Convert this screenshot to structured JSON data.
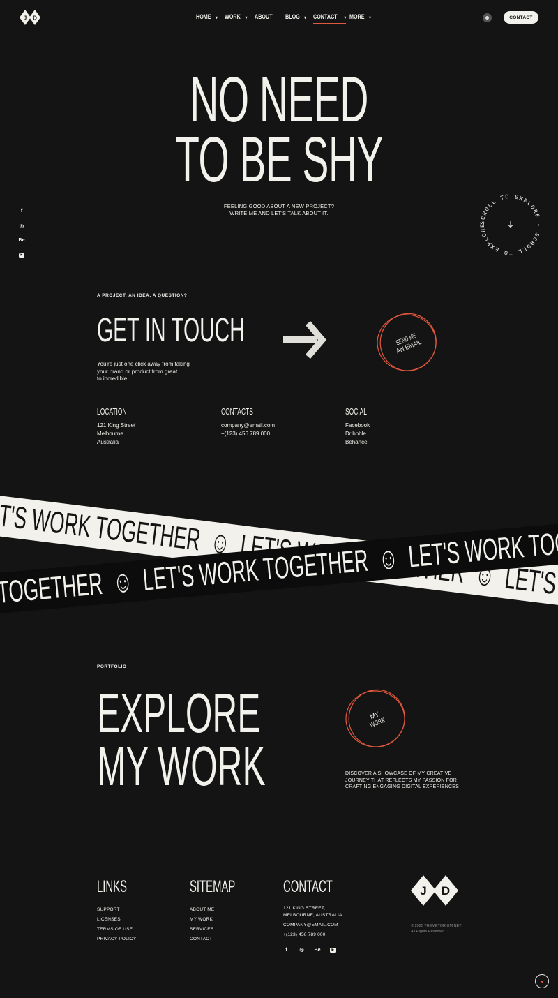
{
  "header": {
    "logo_text": "J D",
    "nav": [
      {
        "label": "HOME",
        "has_dropdown": true
      },
      {
        "label": "WORK",
        "has_dropdown": true
      },
      {
        "label": "ABOUT",
        "has_dropdown": false
      },
      {
        "label": "BLOG",
        "has_dropdown": true
      },
      {
        "label": "CONTACT",
        "has_dropdown": true,
        "active": true
      },
      {
        "label": "MORE",
        "has_dropdown": true
      }
    ],
    "contact_button": "CONTACT"
  },
  "hero": {
    "title_line1": "NO NEED",
    "title_line2": "TO BE SHY",
    "subtitle_line1": "FEELING GOOD ABOUT A NEW PROJECT?",
    "subtitle_line2": "WRITE ME AND LET'S TALK ABOUT IT.",
    "scroll_badge": "SCROLL TO EXPLORE - SCROLL TO EXPLORE - "
  },
  "social_rail": {
    "facebook": "f",
    "dribbble": "◎",
    "behance": "Be",
    "youtube": "▶"
  },
  "contact": {
    "eyebrow": "A PROJECT, AN IDEA, A QUESTION?",
    "title": "GET IN TOUCH",
    "body_line1": "You're just one click away from taking",
    "body_line2": "your brand or product from great",
    "body_line3": "to incredible.",
    "cta_line1": "SEND ME",
    "cta_line2": "AN EMAIL",
    "columns": [
      {
        "heading": "LOCATION",
        "lines": [
          "121 King Street",
          "Melbourne",
          "Australia"
        ]
      },
      {
        "heading": "CONTACTS",
        "lines": [
          "company@email.com",
          "+(123) 456 789 000"
        ]
      },
      {
        "heading": "SOCIAL",
        "lines": [
          "Facebook",
          "Dribbble",
          "Behance"
        ]
      }
    ]
  },
  "tapes": {
    "text": "LET'S WORK TOGETHER",
    "smiley": "☺"
  },
  "portfolio": {
    "eyebrow": "PORTFOLIO",
    "title_line1": "EXPLORE",
    "title_line2": "MY WORK",
    "cta_line1": "MY",
    "cta_line2": "WORK",
    "desc_line1": "DISCOVER A SHOWCASE OF MY CREATIVE",
    "desc_line2": "JOURNEY THAT REFLECTS MY PASSION FOR",
    "desc_line3": "CRAFTING ENGAGING DIGITAL EXPERIENCES"
  },
  "footer": {
    "links_heading": "LINKS",
    "links": [
      "SUPPORT",
      "LICENSES",
      "TERMS OF USE",
      "PRIVACY POLICY"
    ],
    "sitemap_heading": "SITEMAP",
    "sitemap": [
      "ABOUT ME",
      "MY WORK",
      "SERVICES",
      "CONTACT"
    ],
    "contact_heading": "CONTACT",
    "address_line1": "121 KING STREET,",
    "address_line2": "MELBOURNE, AUSTRALIA",
    "email": "COMPANY@EMAIL.COM",
    "phone": "+(123) 456 789 000",
    "social": {
      "facebook": "f",
      "dribbble": "◎",
      "behance": "Bē",
      "youtube": "▶"
    },
    "copyright_line1": "© 2025 THEMETORIUM.NET",
    "copyright_line2": "All Rights Reserved"
  },
  "colors": {
    "background": "#141414",
    "text": "#f2f1ec",
    "accent": "#e2583e"
  }
}
